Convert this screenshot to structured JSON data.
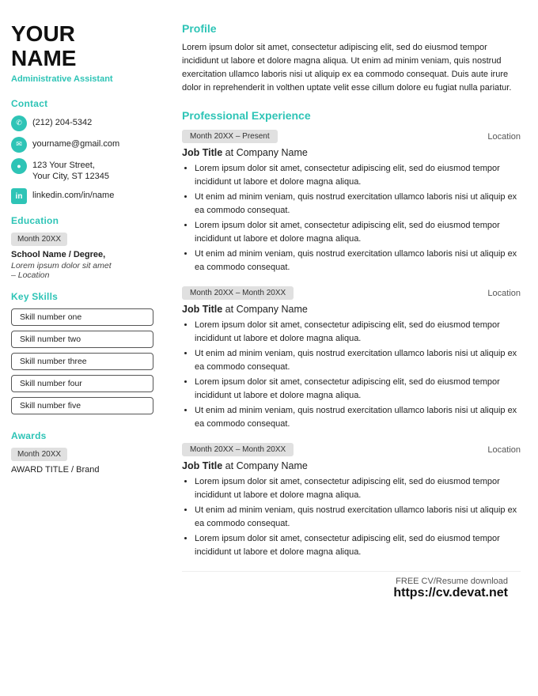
{
  "sidebar": {
    "name_line1": "YOUR",
    "name_line2": "NAME",
    "job_title": "Administrative Assistant",
    "contact_label": "Contact",
    "contact_items": [
      {
        "icon": "phone",
        "text": "(212) 204-5342"
      },
      {
        "icon": "email",
        "text": "yourname@gmail.com"
      },
      {
        "icon": "address",
        "text": "123 Your Street,\nYour City, ST 12345"
      },
      {
        "icon": "linkedin",
        "text": "linkedin.com/in/name"
      }
    ],
    "education_label": "Education",
    "education": {
      "date_badge": "Month 20XX",
      "school": "School Name / Degree,",
      "desc": "Lorem ipsum dolor sit amet\n– Location"
    },
    "skills_label": "Key Skills",
    "skills": [
      "Skill number one",
      "Skill number two",
      "Skill number three",
      "Skill number four",
      "Skill number five"
    ],
    "awards_label": "Awards",
    "awards": {
      "date_badge": "Month 20XX",
      "title": "AWARD TITLE / Brand"
    }
  },
  "main": {
    "profile_label": "Profile",
    "profile_text": "Lorem ipsum dolor sit amet, consectetur adipiscing elit, sed do eiusmod tempor incididunt ut labore et dolore magna aliqua. Ut enim ad minim veniam, quis nostrud exercitation ullamco laboris nisi ut aliquip ex ea commodo consequat. Duis aute irure dolor in reprehenderit in volthen uptate velit esse cillum dolore eu fugiat nulla pariatur.",
    "experience_label": "Professional Experience",
    "experiences": [
      {
        "date_badge": "Month 20XX – Present",
        "location": "Location",
        "job_title": "Job Title",
        "company": "Company Name",
        "bullets": [
          "Lorem ipsum dolor sit amet, consectetur adipiscing elit, sed do eiusmod tempor incididunt ut labore et dolore magna aliqua.",
          "Ut enim ad minim veniam, quis nostrud exercitation ullamco laboris nisi ut aliquip ex ea commodo consequat.",
          "Lorem ipsum dolor sit amet, consectetur adipiscing elit, sed do eiusmod tempor incididunt ut labore et dolore magna aliqua.",
          "Ut enim ad minim veniam, quis nostrud exercitation ullamco laboris nisi ut aliquip ex ea commodo consequat."
        ]
      },
      {
        "date_badge": "Month 20XX – Month 20XX",
        "location": "Location",
        "job_title": "Job Title",
        "company": "Company Name",
        "bullets": [
          "Lorem ipsum dolor sit amet, consectetur adipiscing elit, sed do eiusmod tempor incididunt ut labore et dolore magna aliqua.",
          "Ut enim ad minim veniam, quis nostrud exercitation ullamco laboris nisi ut aliquip ex ea commodo consequat.",
          "Lorem ipsum dolor sit amet, consectetur adipiscing elit, sed do eiusmod tempor incididunt ut labore et dolore magna aliqua.",
          "Ut enim ad minim veniam, quis nostrud exercitation ullamco laboris nisi ut aliquip ex ea commodo consequat."
        ]
      },
      {
        "date_badge": "Month 20XX – Month 20XX",
        "location": "Location",
        "job_title": "Job Title",
        "company": "Company Name",
        "bullets": [
          "Lorem ipsum dolor sit amet, consectetur adipiscing elit, sed do eiusmod tempor incididunt ut labore et dolore magna aliqua.",
          "Ut enim ad minim veniam, quis nostrud exercitation ullamco laboris nisi ut aliquip ex ea commodo consequat.",
          "Lorem ipsum dolor sit amet, consectetur adipiscing elit, sed do eiusmod tempor incididunt ut labore et dolore magna aliqua."
        ]
      }
    ]
  },
  "footer": {
    "free_text": "FREE CV/Resume download",
    "url": "https://cv.devat.net"
  },
  "icons": {
    "phone": "📞",
    "email": "✉",
    "address": "📍",
    "linkedin": "in"
  },
  "colors": {
    "accent": "#2ec4b6",
    "badge_bg": "#e0e0e0",
    "text_dark": "#111",
    "text_mid": "#444"
  }
}
